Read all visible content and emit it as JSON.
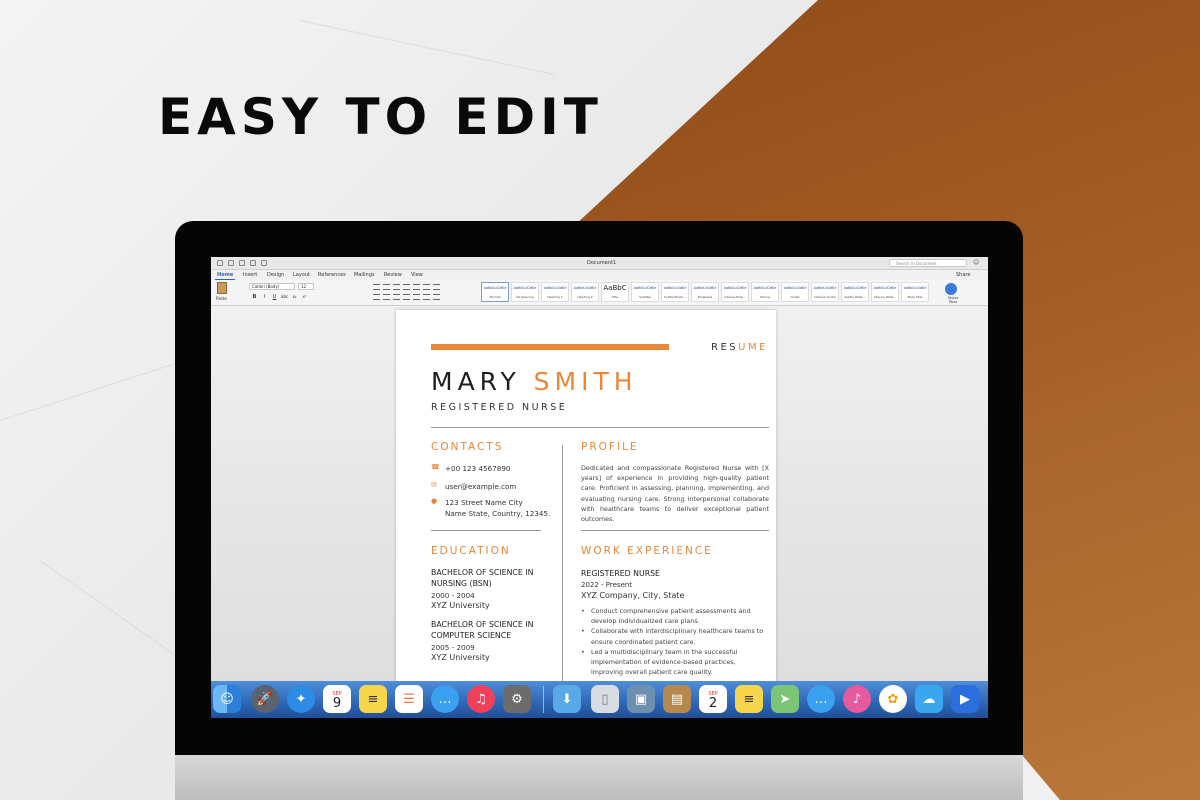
{
  "headline": "EASY TO EDIT",
  "window": {
    "document_title": "Document1",
    "search_placeholder": "Search in Document",
    "share_label": "Share"
  },
  "ribbon": {
    "tabs": [
      "Home",
      "Insert",
      "Design",
      "Layout",
      "References",
      "Mailings",
      "Review",
      "View"
    ],
    "active_tab": "Home",
    "paste_label": "Paste",
    "font_name": "Calibri (Body)",
    "font_size": "12",
    "format_buttons": [
      "B",
      "I",
      "U",
      "abc",
      "x₂",
      "x²"
    ],
    "styles": [
      {
        "sample": "AaBbCcDdEe",
        "name": "Normal"
      },
      {
        "sample": "AaBbCcDdEe",
        "name": "No Spacing"
      },
      {
        "sample": "AaBbCcDdEe",
        "name": "Heading 1"
      },
      {
        "sample": "AaBbCcDdEe",
        "name": "Heading 2"
      },
      {
        "sample": "AaBbC",
        "name": "Title"
      },
      {
        "sample": "AaBbCcDdEe",
        "name": "Subtitle"
      },
      {
        "sample": "AaBbCcDdEe",
        "name": "Subtle Emph..."
      },
      {
        "sample": "AaBbCcDdEe",
        "name": "Emphasis"
      },
      {
        "sample": "AaBbCcDdEe",
        "name": "Intense Emp..."
      },
      {
        "sample": "AaBbCcDdEe",
        "name": "Strong"
      },
      {
        "sample": "AaBbCcDdEe",
        "name": "Quote"
      },
      {
        "sample": "AaBbCcDdEe",
        "name": "Intense Quote"
      },
      {
        "sample": "AaBbCcDdEe",
        "name": "Subtle Refer..."
      },
      {
        "sample": "AaBbCcDdEe",
        "name": "Intense Refer..."
      },
      {
        "sample": "AaBbCcDdEe",
        "name": "Book Title"
      }
    ],
    "styles_pane_label": "Styles Pane"
  },
  "resume": {
    "label_plain": "RES",
    "label_accent": "UME",
    "first_name": "MARY",
    "last_name": "SMITH",
    "job_title": "REGISTERED NURSE",
    "contacts_heading": "CONTACTS",
    "phone": "+00 123 4567890",
    "email": "user@example.com",
    "address_line1": "123 Street Name City",
    "address_line2": "Name State, Country, 12345.",
    "education_heading": "EDUCATION",
    "education": [
      {
        "degree": "BACHELOR OF SCIENCE IN NURSING (BSN)",
        "years": "2000 - 2004",
        "school": "XYZ University"
      },
      {
        "degree": "BACHELOR OF SCIENCE IN COMPUTER SCIENCE",
        "years": "2005 - 2009",
        "school": "XYZ University"
      }
    ],
    "profile_heading": "PROFILE",
    "profile_text": "Dedicated and compassionate Registered Nurse with [X years] of experience in providing high-quality patient care. Proficient in assessing, planning, implementing, and evaluating nursing care. Strong interpersonal collaborate with healthcare teams to deliver exceptional patient outcomes.",
    "work_heading": "WORK EXPERIENCE",
    "work_title": "REGISTERED NURSE",
    "work_dates": "2022 - Present",
    "work_company": "XYZ Company, City, State",
    "work_bullets": [
      "Conduct comprehensive patient assessments and develop individualized care plans.",
      "Collaborate with interdisciplinary healthcare teams to ensure coordinated patient care.",
      "Led a multidisciplinary team in the successful implementation of evidence-based practices, improving overall patient care quality."
    ]
  },
  "dock": {
    "calendar_day_1": "9",
    "calendar_month_1": "SEP",
    "calendar_day_2": "2",
    "calendar_month_2": "SEP",
    "icons": [
      {
        "name": "finder-icon",
        "color": "#3f8ee8"
      },
      {
        "name": "launchpad-icon",
        "color": "#5a6470"
      },
      {
        "name": "safari-icon",
        "color": "#2d8ae5"
      },
      {
        "name": "calendar-icon",
        "color": "#ffffff"
      },
      {
        "name": "notes-icon",
        "color": "#f7d54a"
      },
      {
        "name": "reminders-icon",
        "color": "#ffffff"
      },
      {
        "name": "messages-icon",
        "color": "#3aa0f0"
      },
      {
        "name": "music-icon",
        "color": "#f0405a"
      },
      {
        "name": "system-preferences-icon",
        "color": "#6c6c6c"
      },
      {
        "name": "downloads-folder-icon",
        "color": "#59a9e8"
      },
      {
        "name": "trash-icon",
        "color": "#d8dde3"
      },
      {
        "name": "preview-icon",
        "color": "#6d8fb0"
      },
      {
        "name": "contacts-icon",
        "color": "#b5894e"
      },
      {
        "name": "calendar-icon",
        "color": "#ffffff"
      },
      {
        "name": "notes-icon",
        "color": "#f7d54a"
      },
      {
        "name": "maps-icon",
        "color": "#7cc576"
      },
      {
        "name": "messages-icon",
        "color": "#3aa0f0"
      },
      {
        "name": "itunes-icon",
        "color": "#e55b9e"
      },
      {
        "name": "photos-icon",
        "color": "#ffffff"
      },
      {
        "name": "icloud-icon",
        "color": "#3aa6ef"
      },
      {
        "name": "facetime-icon",
        "color": "#2a6fdd"
      }
    ]
  },
  "colors": {
    "accent_orange": "#e8873a",
    "copper": "#9c5620",
    "monitor_bezel": "#050505",
    "ribbon_blue": "#2f63b5"
  }
}
